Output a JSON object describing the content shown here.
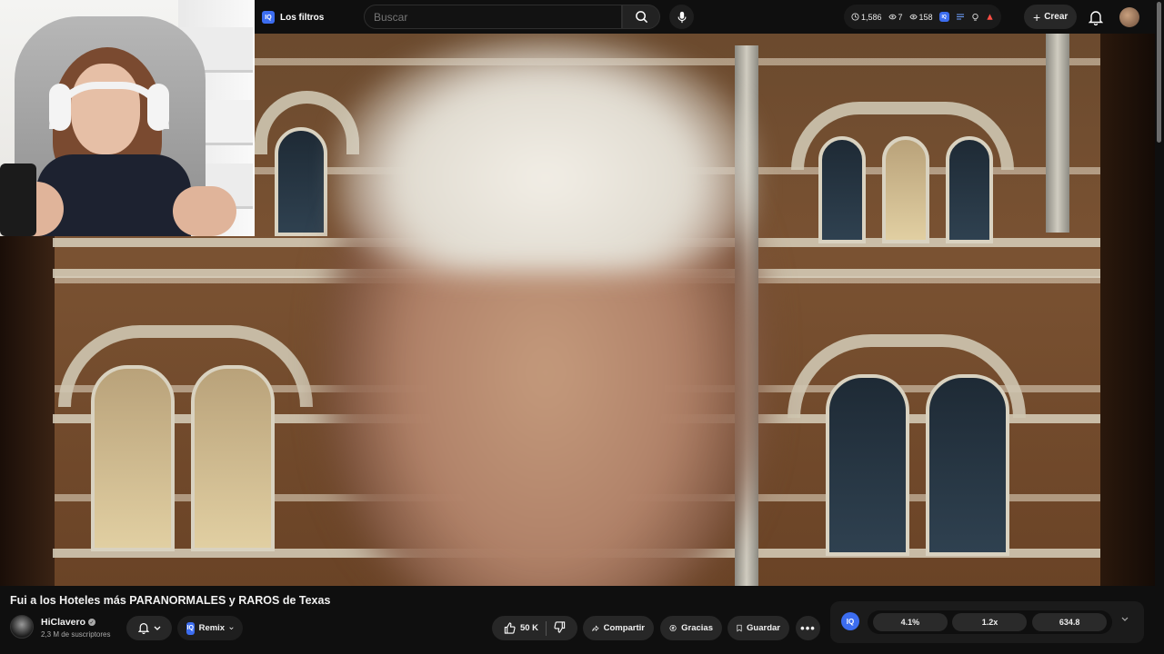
{
  "header": {
    "filters_label": "Los filtros",
    "search_placeholder": "Buscar",
    "stats": {
      "watch_time": "1,586",
      "views": "7",
      "impressions": "158"
    },
    "create_label": "Crear"
  },
  "video": {
    "title": "Fui a los Hoteles más PARANORMALES y RAROS de Texas",
    "channel_name": "HiClavero",
    "subscribers": "2,3 M de suscriptores",
    "remix_label": "Remix",
    "likes": "50 K",
    "share_label": "Compartir",
    "thanks_label": "Gracias",
    "save_label": "Guardar"
  },
  "iq_panel": {
    "logo_text": "IQ",
    "metrics": [
      "4.1%",
      "1.2x",
      "634.8"
    ]
  },
  "icons": [
    "search-icon",
    "mic-icon",
    "clock-icon",
    "eye-icon",
    "plus-icon",
    "bell-icon",
    "verified-icon",
    "like-icon",
    "dislike-icon",
    "share-icon",
    "thanks-icon",
    "save-icon",
    "more-icon",
    "chevron-down-icon"
  ],
  "colors": {
    "accent": "#3c6df0",
    "background": "#0f0f0f",
    "chip": "#272727",
    "notify_red": "#ff4e45"
  }
}
